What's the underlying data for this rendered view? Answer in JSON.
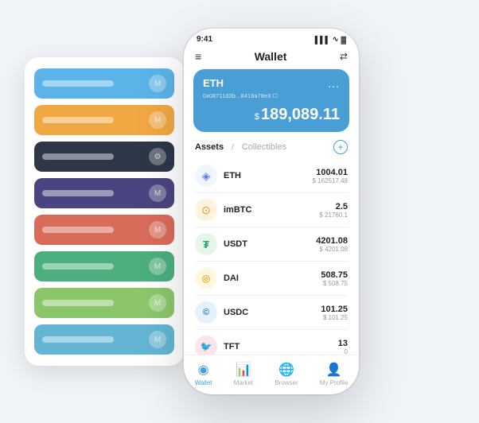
{
  "scene": {
    "background": "#f0f4f8"
  },
  "cardStack": {
    "cards": [
      {
        "color": "card-blue",
        "id": "card-1"
      },
      {
        "color": "card-orange",
        "id": "card-2"
      },
      {
        "color": "card-dark",
        "id": "card-3"
      },
      {
        "color": "card-purple",
        "id": "card-4"
      },
      {
        "color": "card-red",
        "id": "card-5"
      },
      {
        "color": "card-green",
        "id": "card-6"
      },
      {
        "color": "card-light-green",
        "id": "card-7"
      },
      {
        "color": "card-light-blue",
        "id": "card-8"
      }
    ]
  },
  "phone": {
    "statusBar": {
      "time": "9:41",
      "signal": "▌▌▌",
      "wifi": "▾",
      "battery": "▓"
    },
    "nav": {
      "menuIcon": "≡",
      "title": "Wallet",
      "expandIcon": "⇄"
    },
    "ethCard": {
      "label": "ETH",
      "address": "0x08711d3b...8418a78e3 ☐",
      "dots": "...",
      "balanceCurrency": "$",
      "balance": "189,089.11"
    },
    "assetsTabs": {
      "assetsLabel": "Assets",
      "separator": "/",
      "collectiblesLabel": "Collectibles",
      "addIcon": "+"
    },
    "assets": [
      {
        "symbol": "ETH",
        "iconEmoji": "◈",
        "iconClass": "eth-icon",
        "amount": "1004.01",
        "usd": "$ 162517.48"
      },
      {
        "symbol": "imBTC",
        "iconEmoji": "⊙",
        "iconClass": "imbtc-icon",
        "amount": "2.5",
        "usd": "$ 21760.1"
      },
      {
        "symbol": "USDT",
        "iconEmoji": "₮",
        "iconClass": "usdt-icon",
        "amount": "4201.08",
        "usd": "$ 4201.08"
      },
      {
        "symbol": "DAI",
        "iconEmoji": "◎",
        "iconClass": "dai-icon",
        "amount": "508.75",
        "usd": "$ 508.75"
      },
      {
        "symbol": "USDC",
        "iconEmoji": "©",
        "iconClass": "usdc-icon",
        "amount": "101.25",
        "usd": "$ 101.25"
      },
      {
        "symbol": "TFT",
        "iconEmoji": "❤",
        "iconClass": "tft-icon",
        "amount": "13",
        "usd": "0"
      }
    ],
    "bottomNav": [
      {
        "label": "Wallet",
        "icon": "◉",
        "active": true
      },
      {
        "label": "Market",
        "icon": "📈",
        "active": false
      },
      {
        "label": "Browser",
        "icon": "🌐",
        "active": false
      },
      {
        "label": "My Profile",
        "icon": "👤",
        "active": false
      }
    ]
  }
}
